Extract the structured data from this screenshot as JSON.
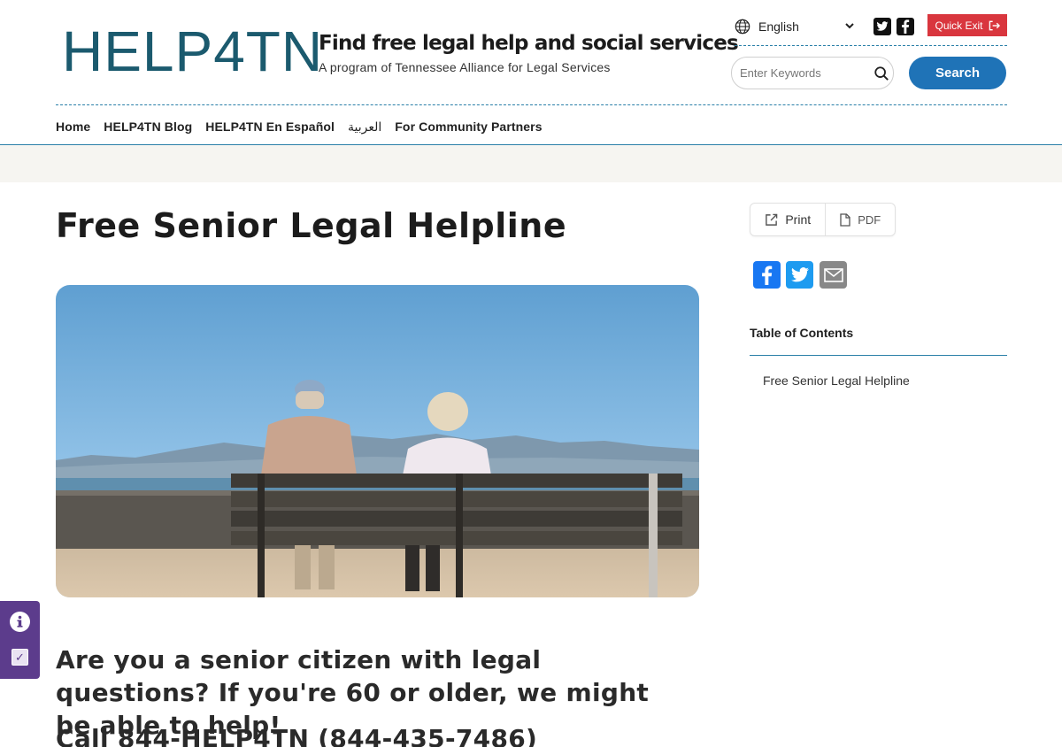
{
  "header": {
    "logo": "HELP4TN",
    "tagline": "Find free legal help and social services",
    "subtagline": "A program of Tennessee Alliance for Legal Services",
    "language": "English",
    "quick_exit": "Quick Exit",
    "search_placeholder": "Enter Keywords",
    "search_button": "Search"
  },
  "nav": {
    "items": [
      {
        "label": "Home"
      },
      {
        "label": "HELP4TN Blog"
      },
      {
        "label": "HELP4TN En Español"
      },
      {
        "label": "العربية"
      },
      {
        "label": "For Community Partners"
      }
    ]
  },
  "main": {
    "title": "Free Senior Legal Helpline",
    "lead": "Are you a senior citizen with legal questions?  If you're 60 or older, we might be able to help!",
    "call": "Call 844-HELP4TN  (844-435-7486)"
  },
  "sidebar": {
    "print_label": "Print",
    "pdf_label": "PDF",
    "toc_title": "Table of Contents",
    "toc_items": [
      {
        "label": "Free Senior Legal Helpline"
      }
    ]
  },
  "colors": {
    "brand": "#1b5a6e",
    "accent": "#1f73b7",
    "quick_exit": "#d9363e",
    "widget": "#5c3c8c"
  }
}
